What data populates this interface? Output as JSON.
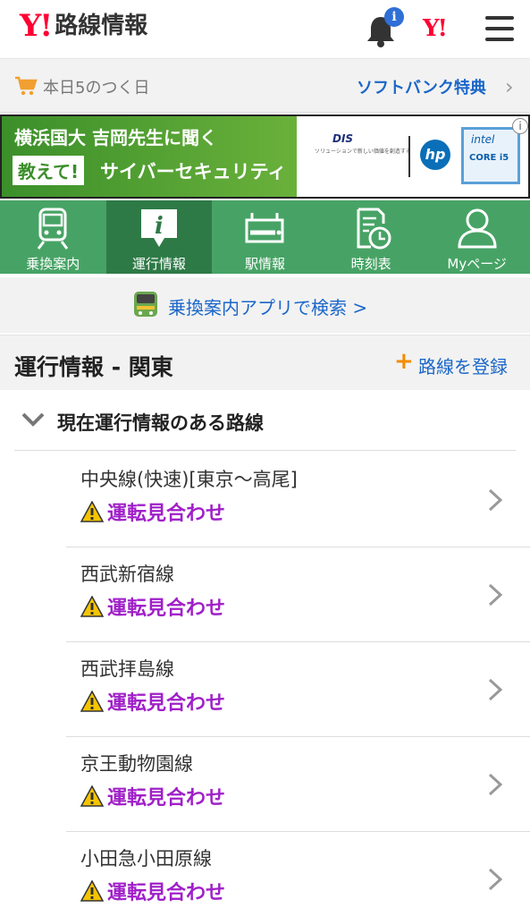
{
  "header": {
    "logo_mark": "Y!",
    "logo_text": "路線情報",
    "notification_badge": "i",
    "yahoo_mark": "Y!",
    "icons": [
      "bell-icon",
      "menu-icon"
    ]
  },
  "promo": {
    "left_text": "本日5のつく日",
    "right_link": "ソフトバンク特典",
    "chevron": "›"
  },
  "ad": {
    "line1": "横浜国大 吉岡先生に聞く",
    "tag": "教えて!",
    "line2": "サイバーセキュリティ",
    "dis_logo": "DIS",
    "dis_sub": "ソリューションで新しい価値を創造する",
    "hp_logo": "hp",
    "intel_logo": "intel",
    "intel_core": "CORE i5",
    "info_icon": "i"
  },
  "nav": {
    "items": [
      {
        "label": "乗換案内",
        "icon": "train-icon",
        "active": false
      },
      {
        "label": "運行情報",
        "icon": "info-icon",
        "active": true
      },
      {
        "label": "駅情報",
        "icon": "station-icon",
        "active": false
      },
      {
        "label": "時刻表",
        "icon": "timetable-icon",
        "active": false
      },
      {
        "label": "Myページ",
        "icon": "person-icon",
        "active": false
      }
    ],
    "active_color": "#2e7a47",
    "bg_color": "#47a365"
  },
  "app_link": {
    "text": "乗換案内アプリで検索 >"
  },
  "section": {
    "title": "運行情報 - 関東",
    "register_plus": "+",
    "register_label": "路線を登録"
  },
  "accordion": {
    "title": "現在運行情報のある路線"
  },
  "lines": [
    {
      "name": "中央線(快速)[東京〜高尾]",
      "status": "運転見合わせ"
    },
    {
      "name": "西武新宿線",
      "status": "運転見合わせ"
    },
    {
      "name": "西武拝島線",
      "status": "運転見合わせ"
    },
    {
      "name": "京王動物園線",
      "status": "運転見合わせ"
    },
    {
      "name": "小田急小田原線",
      "status": "運転見合わせ"
    }
  ],
  "colors": {
    "status": "#a020c8",
    "link": "#1a66c9",
    "brand": "#ff0033",
    "warning": "#f5c400"
  }
}
